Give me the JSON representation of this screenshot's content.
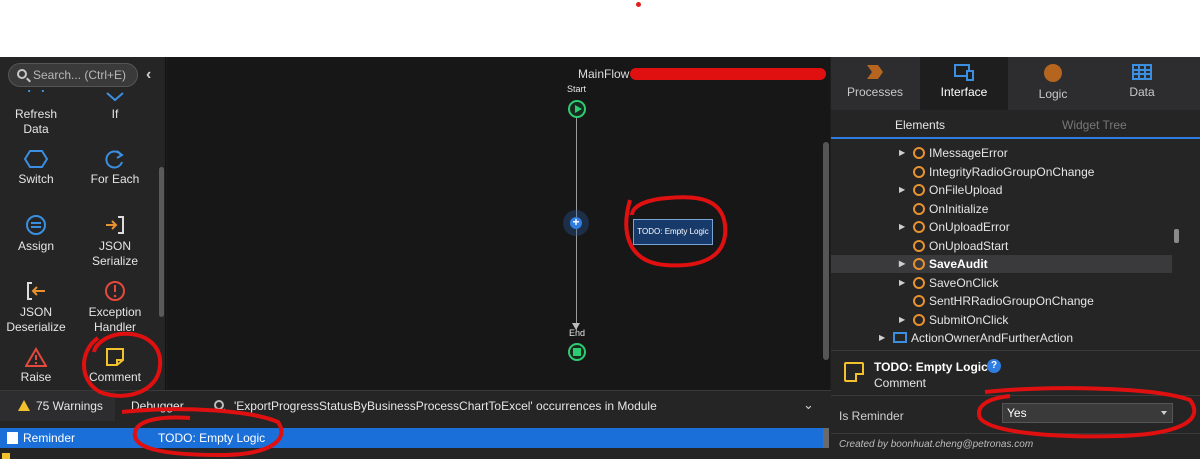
{
  "toolbox": {
    "search_placeholder": "Search... (Ctrl+E)",
    "items": [
      {
        "label": "Refresh Data",
        "icon": "refresh-data-icon"
      },
      {
        "label": "If",
        "icon": "if-icon"
      },
      {
        "label": "Switch",
        "icon": "switch-icon"
      },
      {
        "label": "For Each",
        "icon": "for-each-icon"
      },
      {
        "label": "Assign",
        "icon": "assign-icon"
      },
      {
        "label": "JSON Serialize",
        "icon": "json-serialize-icon"
      },
      {
        "label": "JSON Deserialize",
        "icon": "json-deserialize-icon"
      },
      {
        "label": "Exception Handler",
        "icon": "exception-handler-icon"
      },
      {
        "label": "Raise",
        "icon": "raise-icon"
      },
      {
        "label": "Comment",
        "icon": "comment-icon"
      }
    ]
  },
  "canvas": {
    "flow_title": "MainFlow",
    "start_label": "Start",
    "end_label": "End",
    "comment_text": "TODO: Empty Logic"
  },
  "right_panel": {
    "tabs": [
      {
        "label": "Processes",
        "icon": "processes-icon"
      },
      {
        "label": "Interface",
        "icon": "interface-icon"
      },
      {
        "label": "Logic",
        "icon": "logic-icon"
      },
      {
        "label": "Data",
        "icon": "data-icon"
      }
    ],
    "active_tab": "Interface",
    "subtabs": {
      "elements": "Elements",
      "widget_tree": "Widget Tree"
    },
    "tree": [
      {
        "label": "IMessageError",
        "expandable": true
      },
      {
        "label": "IntegrityRadioGroupOnChange",
        "expandable": false
      },
      {
        "label": "OnFileUpload",
        "expandable": true
      },
      {
        "label": "OnInitialize",
        "expandable": false
      },
      {
        "label": "OnUploadError",
        "expandable": true
      },
      {
        "label": "OnUploadStart",
        "expandable": false
      },
      {
        "label": "SaveAudit",
        "expandable": true,
        "selected": true
      },
      {
        "label": "SaveOnClick",
        "expandable": true
      },
      {
        "label": "SentHRRadioGroupOnChange",
        "expandable": false
      },
      {
        "label": "SubmitOnClick",
        "expandable": true
      },
      {
        "label": "ActionOwnerAndFurtherAction",
        "expandable": true
      }
    ],
    "properties": {
      "title": "TODO: Empty Logic",
      "subtitle": "Comment",
      "help_label": "?",
      "is_reminder_label": "Is Reminder",
      "is_reminder_value": "Yes",
      "created_by": "Created by boonhuat.cheng@petronas.com"
    }
  },
  "bottom_panel": {
    "warnings_tab": "75 Warnings",
    "debugger_tab": "Debugger",
    "search_tab": "'ExportProgressStatusByBusinessProcessChartToExcel' occurrences in Module",
    "row": {
      "type": "Reminder",
      "message": "TODO: Empty Logic"
    }
  },
  "colors": {
    "accent": "#2f7de1",
    "annotation": "#e01010",
    "warning": "#f2c12e",
    "action_ring": "#e8912f",
    "start_end": "#2ecc71"
  }
}
